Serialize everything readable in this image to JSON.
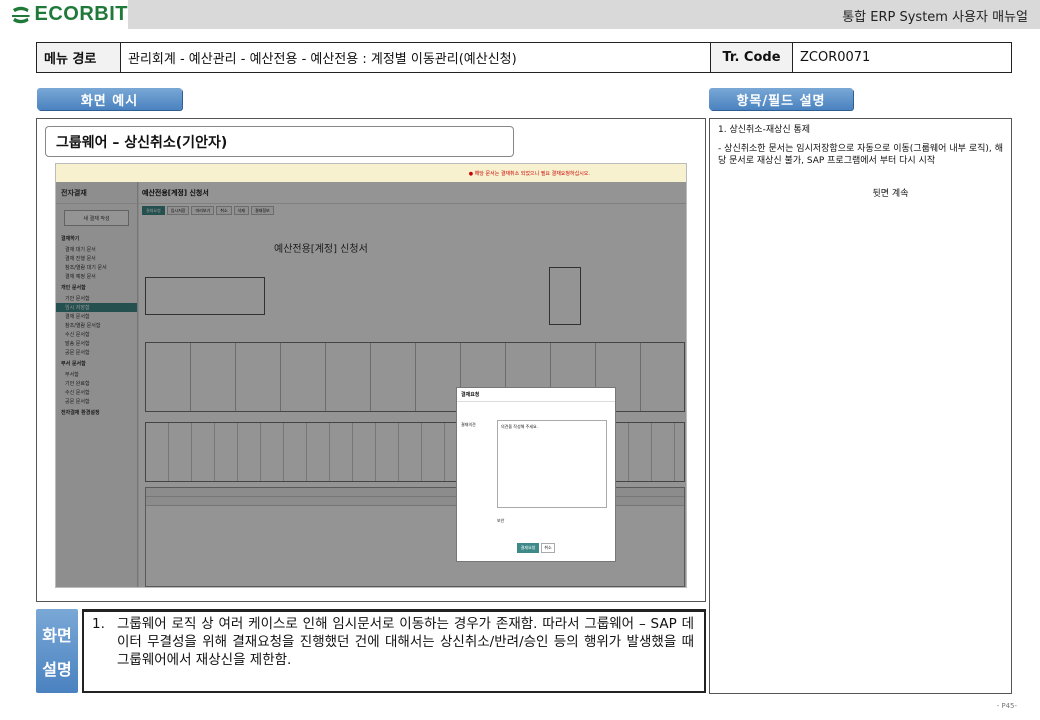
{
  "header": {
    "logo_text": "ECORBIT",
    "manual_title": "통합 ERP System 사용자 매뉴얼"
  },
  "info": {
    "menu_path_label": "메뉴 경로",
    "menu_path_value": "관리회계 - 예산관리 - 예산전용 - 예산전용 : 계정별 이동관리(예산신청)",
    "tr_code_label": "Tr. Code",
    "tr_code_value": "ZCOR0071"
  },
  "sections": {
    "screen_example": "화면 예시",
    "field_description": "항목/필드 설명"
  },
  "screen": {
    "caption": "그룹웨어 – 상신취소(기안자)",
    "shot": {
      "notice": "● 해당 문서는 결재취소 되었으니 필요 결재요청하십시오.",
      "side_title": "전자결재",
      "new_doc_button": "새 결재 작성",
      "side_groups": [
        {
          "label": "결재하기",
          "items": [
            "결재 대기 문서",
            "결재 진행 문서",
            "참조/열람 대기 문서",
            "결재 예정 문서"
          ]
        },
        {
          "label": "개인 문서함",
          "items": [
            "기안 문서함",
            "임시 저장함",
            "결재 문서함",
            "참조/열람 문서함",
            "수신 문서함",
            "발송 문서함",
            "공문 문서함"
          ]
        },
        {
          "label": "부서 문서함",
          "items": [
            "부서함",
            "기안 완료함",
            "수신 문서함",
            "공문 문서함"
          ]
        },
        {
          "label": "전자결재 환경설정",
          "items": []
        }
      ],
      "active_item": "임시 저장함",
      "main_title": "예산전용[계정] 신청서",
      "tabs": [
        "결재요청",
        "임시저장",
        "미리보기",
        "취소",
        "삭제",
        "결재정보"
      ],
      "doc_title": "예산전용[계정] 신청서",
      "dialog_title": "결재요청",
      "dialog_field": "결재의견",
      "dialog_placeholder": "의견을 작성해 주세요.",
      "dialog_check": "보안",
      "dialog_ok": "결재요청",
      "dialog_cancel": "취소"
    }
  },
  "field_panel": {
    "heading": "1. 상신취소-재상신 통제",
    "body": " - 상신취소한 문서는 임시저장함으로 자동으로 이동(그룹웨어 내부 로직), 해당 문서로 재상신 불가, SAP 프로그램에서 부터 다시 시작",
    "more": "뒷면 계속"
  },
  "explanation": {
    "label_line1": "화면",
    "label_line2": "설명",
    "number": "1.",
    "text": "그룹웨어 로직 상 여러 케이스로 인해 임시문서로 이동하는 경우가 존재함. 따라서 그룹웨어 – SAP 데이터 무결성을 위해 결재요청을 진행했던 건에 대해서는 상신취소/반려/승인 등의 행위가 발생했을 때 그룹웨어에서 재상신을 제한함."
  },
  "page_number": "- P45-"
}
